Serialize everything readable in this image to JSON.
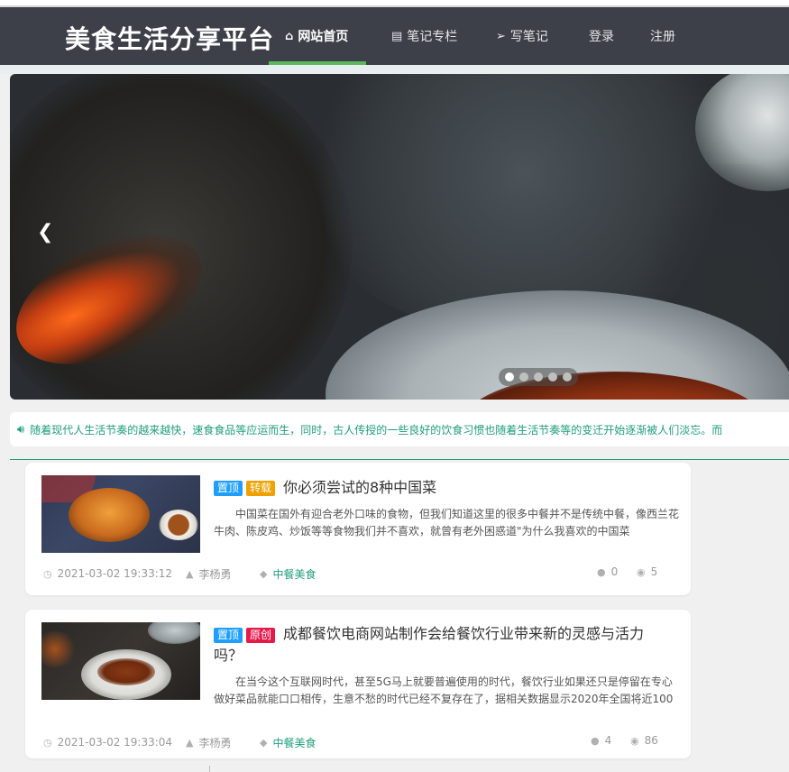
{
  "site": {
    "title": "美食生活分享平台"
  },
  "nav": {
    "items": [
      {
        "label": "网站首页",
        "icon": "home-icon",
        "active": true
      },
      {
        "label": "笔记专栏",
        "icon": "document-icon",
        "active": false
      },
      {
        "label": "写笔记",
        "icon": "paper-plane-icon",
        "active": false
      },
      {
        "label": "登录",
        "icon": "",
        "active": false
      },
      {
        "label": "注册",
        "icon": "",
        "active": false
      }
    ]
  },
  "banner": {
    "prev_icon": "chevron-left-icon",
    "slide_count": 5,
    "active_slide": 1
  },
  "notice": {
    "icon": "speaker-icon",
    "text": "随着现代人生活节奏的越来越快，速食食品等应运而生，同时，古人传授的一些良好的饮食习惯也随着生活节奏等的变迁开始逐渐被人们淡忘。而"
  },
  "articles": [
    {
      "tags": [
        {
          "label": "置顶",
          "kind": "top"
        },
        {
          "label": "转载",
          "kind": "repost"
        }
      ],
      "title": "你必须尝试的8种中国菜",
      "summary": "中国菜在国外有迎合老外口味的食物，但我们知道这里的很多中餐并不是传统中餐，像西兰花牛肉、陈皮鸡、炒饭等等食物我们并不喜欢，就曾有老外困惑道\"为什么我喜欢的中国菜",
      "date": "2021-03-02 19:33:12",
      "author": "李杨勇",
      "category": "中餐美食",
      "comments": "0",
      "views": "5"
    },
    {
      "tags": [
        {
          "label": "置顶",
          "kind": "top"
        },
        {
          "label": "原创",
          "kind": "orig"
        }
      ],
      "title_line1": "成都餐饮电商网站制作会给餐饮行业带来新的灵感与活力",
      "title_line2": "吗？",
      "summary": "在当今这个互联网时代，甚至5G马上就要普遍使用的时代，餐饮行业如果还只是停留在专心做好菜品就能口口相传，生意不愁的时代已经不复存在了，据相关数据显示2020年全国将近100",
      "date": "2021-03-02 19:33:04",
      "author": "李杨勇",
      "category": "中餐美食",
      "comments": "4",
      "views": "86"
    }
  ],
  "colors": {
    "header_bg": "#3d4049",
    "accent_green": "#5cb85c",
    "teal": "#1e9e7e",
    "tag_top": "#1e9fff",
    "tag_repost": "#f0a000",
    "tag_orig": "#e6194b"
  }
}
